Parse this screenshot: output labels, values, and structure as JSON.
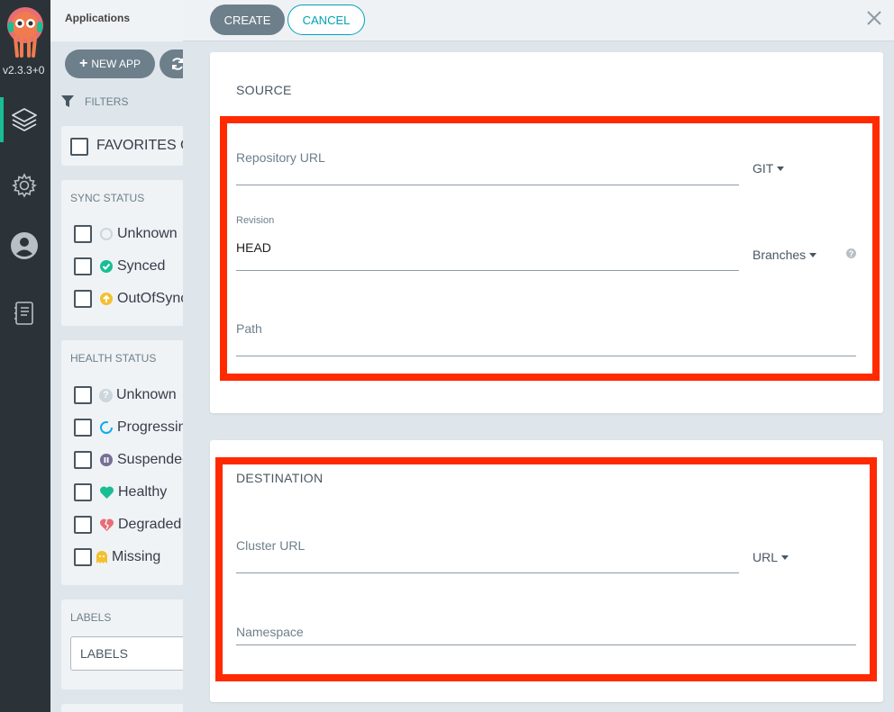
{
  "nav": {
    "version": "v2.3.3+0",
    "items": [
      {
        "name": "applications",
        "icon": "layers-icon"
      },
      {
        "name": "settings",
        "icon": "gear-icon"
      },
      {
        "name": "user",
        "icon": "user-icon"
      },
      {
        "name": "docs",
        "icon": "book-icon"
      }
    ]
  },
  "apps": {
    "title": "Applications",
    "new_app_label": "NEW APP",
    "filters_label": "FILTERS",
    "favorites_label": "FAVORITES O",
    "sync_status": {
      "title": "SYNC STATUS",
      "items": [
        "Unknown",
        "Synced",
        "OutOfSync"
      ]
    },
    "health_status": {
      "title": "HEALTH STATUS",
      "items": [
        "Unknown",
        "Progressin",
        "Suspendec",
        "Healthy",
        "Degraded",
        "Missing"
      ]
    },
    "labels": {
      "title": "LABELS",
      "placeholder": "LABELS"
    }
  },
  "panel": {
    "create_label": "CREATE",
    "cancel_label": "CANCEL",
    "source": {
      "title": "SOURCE",
      "repo_url_label": "Repository URL",
      "repo_type": "GIT",
      "revision_label": "Revision",
      "revision_value": "HEAD",
      "revision_type": "Branches",
      "help": "?",
      "path_label": "Path"
    },
    "destination": {
      "title": "DESTINATION",
      "cluster_url_label": "Cluster URL",
      "cluster_type": "URL",
      "namespace_label": "Namespace"
    }
  },
  "colors": {
    "highlight": "#ff2a00",
    "accent": "#00a2b3",
    "synced": "#18be94",
    "outofsync": "#f4c030",
    "healthy": "#18be94",
    "degraded": "#e96d76",
    "progressing": "#0dadea",
    "suspended": "#766f94"
  }
}
